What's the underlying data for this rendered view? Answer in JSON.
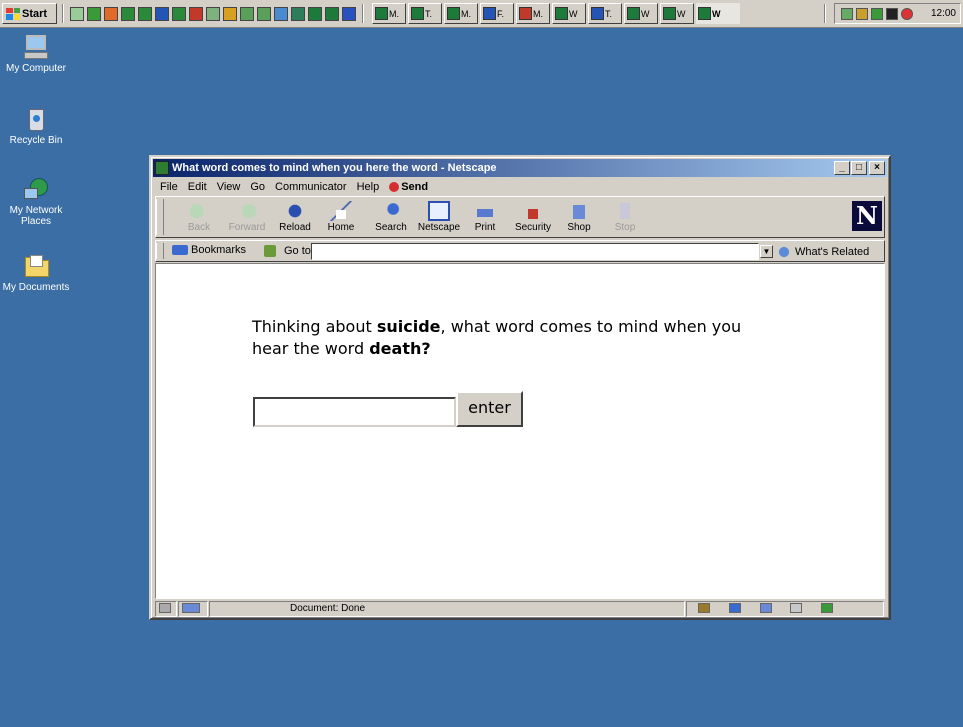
{
  "taskbar": {
    "start_label": "Start",
    "task_buttons": [
      "M.",
      "T.",
      "M.",
      "F.",
      "M.",
      "W",
      "T.",
      "W",
      "W",
      "W"
    ],
    "clock": "12:00"
  },
  "desktop": {
    "icons": [
      {
        "label": "My Computer",
        "icon": "my-computer-icon"
      },
      {
        "label": "Recycle Bin",
        "icon": "recycle-bin-icon"
      },
      {
        "label": "My Network Places",
        "icon": "network-places-icon"
      },
      {
        "label": "My Documents",
        "icon": "my-documents-icon"
      }
    ]
  },
  "window": {
    "title": "What word comes to mind when you here the word - Netscape",
    "menu": [
      "File",
      "Edit",
      "View",
      "Go",
      "Communicator",
      "Help"
    ],
    "menu_send": "Send",
    "toolbar": [
      {
        "label": "Back",
        "icon": "back-icon",
        "enabled": false
      },
      {
        "label": "Forward",
        "icon": "forward-icon",
        "enabled": false
      },
      {
        "label": "Reload",
        "icon": "reload-icon",
        "enabled": true
      },
      {
        "label": "Home",
        "icon": "home-icon",
        "enabled": true
      },
      {
        "label": "Search",
        "icon": "search-icon",
        "enabled": true
      },
      {
        "label": "Netscape",
        "icon": "netscape-icon",
        "enabled": true
      },
      {
        "label": "Print",
        "icon": "print-icon",
        "enabled": true
      },
      {
        "label": "Security",
        "icon": "security-icon",
        "enabled": true
      },
      {
        "label": "Shop",
        "icon": "shop-icon",
        "enabled": true
      },
      {
        "label": "Stop",
        "icon": "stop-icon",
        "enabled": false
      }
    ],
    "logo": "N",
    "location": {
      "bookmarks_label": "Bookmarks",
      "goto_label": "Go to:",
      "url": "",
      "whats_related": "What's Related"
    },
    "content": {
      "question_prefix": "Thinking about ",
      "question_bold1": "suicide",
      "question_mid": ", what word comes to mind when you hear the word ",
      "question_bold2": "death?",
      "answer_value": "",
      "enter_label": "enter"
    },
    "status": "Document: Done"
  },
  "colors": {
    "desktop": "#3a6ea5",
    "titlebar_start": "#0a246a",
    "titlebar_end": "#a6caf0",
    "chrome": "#d4d0c8"
  }
}
